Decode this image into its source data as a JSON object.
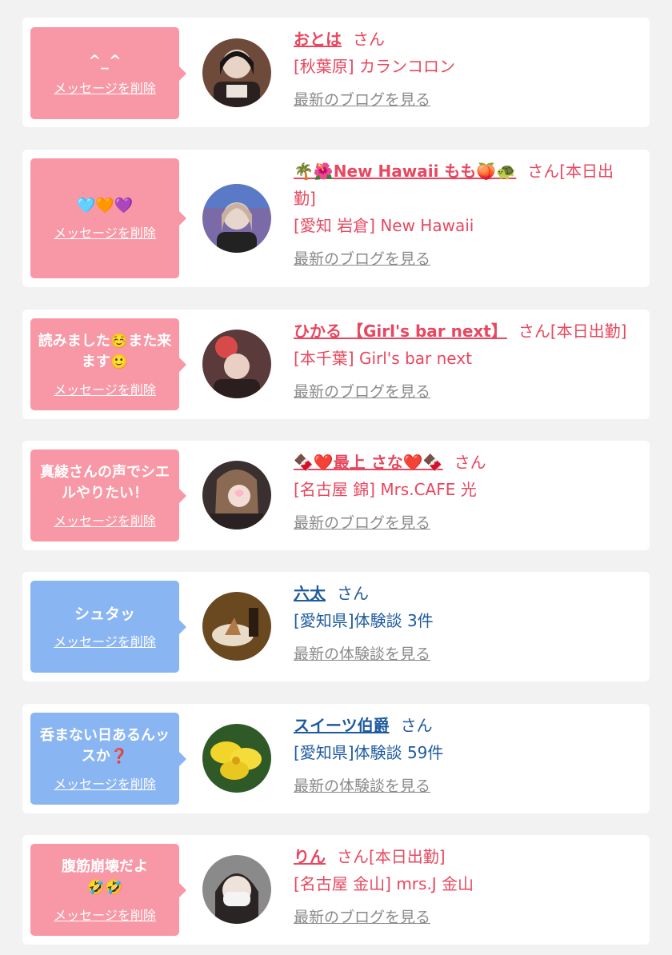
{
  "ui": {
    "delete_label": "メッセージを削除"
  },
  "items": [
    {
      "message": "^_^",
      "name": "おとは",
      "honorific": "さん",
      "shop": "[秋葉原] カランコロン",
      "link": "最新のブログを見る"
    },
    {
      "message": "🩵🧡💜",
      "name": "🌴🌺New Hawaii もも🍑🐢",
      "honorific": "さん[本日出勤]",
      "shop": "[愛知 岩倉] New Hawaii",
      "link": "最新のブログを見る"
    },
    {
      "message": "読みました☺️また来ます🙂",
      "name": "ひかる 【Girl's bar next】",
      "honorific": "さん[本日出勤]",
      "shop": "[本千葉] Girl's bar next",
      "link": "最新のブログを見る"
    },
    {
      "message": "真綾さんの声でシエルやりたい！",
      "name": "🍫❤️最上 さな❤️🍫",
      "honorific": "さん",
      "shop": "[名古屋 錦] Mrs.CAFE 光",
      "link": "最新のブログを見る"
    },
    {
      "message": "シュタッ",
      "name": "六太",
      "honorific": "さん",
      "shop": "[愛知県]体験談 3件",
      "link": "最新の体験談を見る"
    },
    {
      "message": "呑まない日あるんッスか❓",
      "name": "スイーツ伯爵",
      "honorific": "さん",
      "shop": "[愛知県]体験談 59件",
      "link": "最新の体験談を見る"
    },
    {
      "message": "腹筋崩壊だよ🤣🤣",
      "name": "りん",
      "honorific": "さん[本日出勤]",
      "shop": "[名古屋 金山] mrs.J 金山",
      "link": "最新のブログを見る"
    }
  ],
  "colors": {
    "pink_bubble": "#f897a5",
    "blue_bubble": "#8ab5f3",
    "pink_text": "#e8475f",
    "blue_text": "#1e5a9e",
    "link_gray": "#8a8a8a",
    "background": "#f2f2f2"
  }
}
